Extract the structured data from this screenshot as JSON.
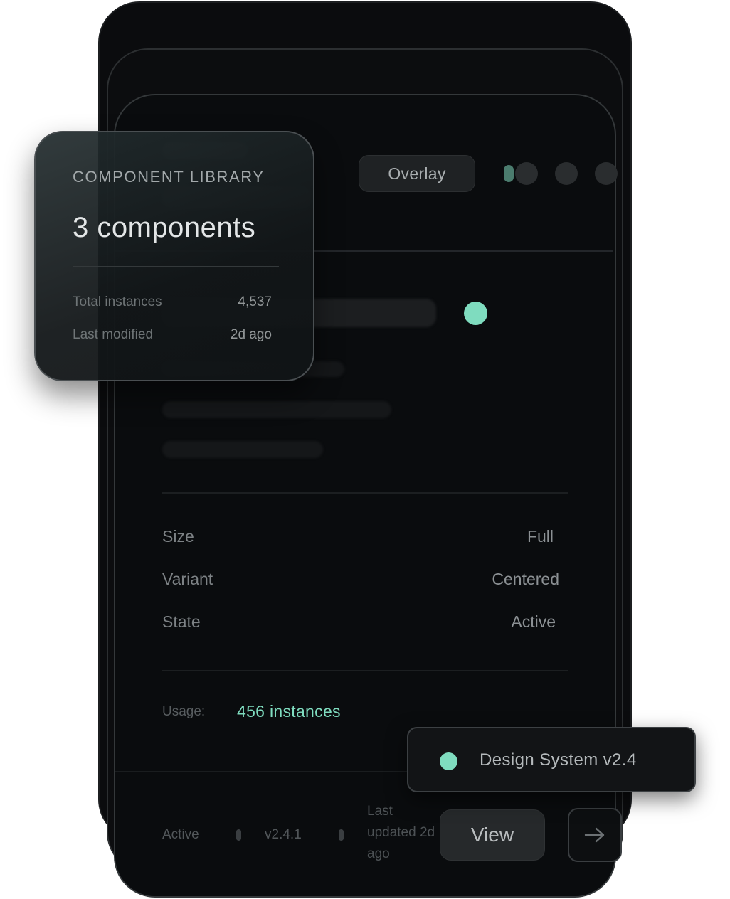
{
  "toolbar": {
    "overlay_label": "Overlay"
  },
  "library_card": {
    "eyebrow": "COMPONENT LIBRARY",
    "title": "3 components",
    "rows": [
      {
        "label": "Total instances",
        "value": "4,537"
      },
      {
        "label": "Last modified",
        "value": "2d ago"
      }
    ]
  },
  "properties": [
    {
      "label": "Size",
      "value": "Full"
    },
    {
      "label": "Variant",
      "value": "Centered"
    },
    {
      "label": "State",
      "value": "Active"
    }
  ],
  "usage": {
    "label": "Usage:",
    "value": "456 instances"
  },
  "footer": {
    "status": "Active",
    "version": "v2.4.1",
    "last_updated": "Last updated 2d ago",
    "view_label": "View"
  },
  "badge": {
    "label": "Design System v2.4"
  },
  "colors": {
    "accent": "#7fdcbf",
    "surface": "#0a0c0e",
    "border": "#34383a"
  },
  "icons": {
    "arrow": "arrow-right-icon",
    "status": "status-dot-icon"
  }
}
